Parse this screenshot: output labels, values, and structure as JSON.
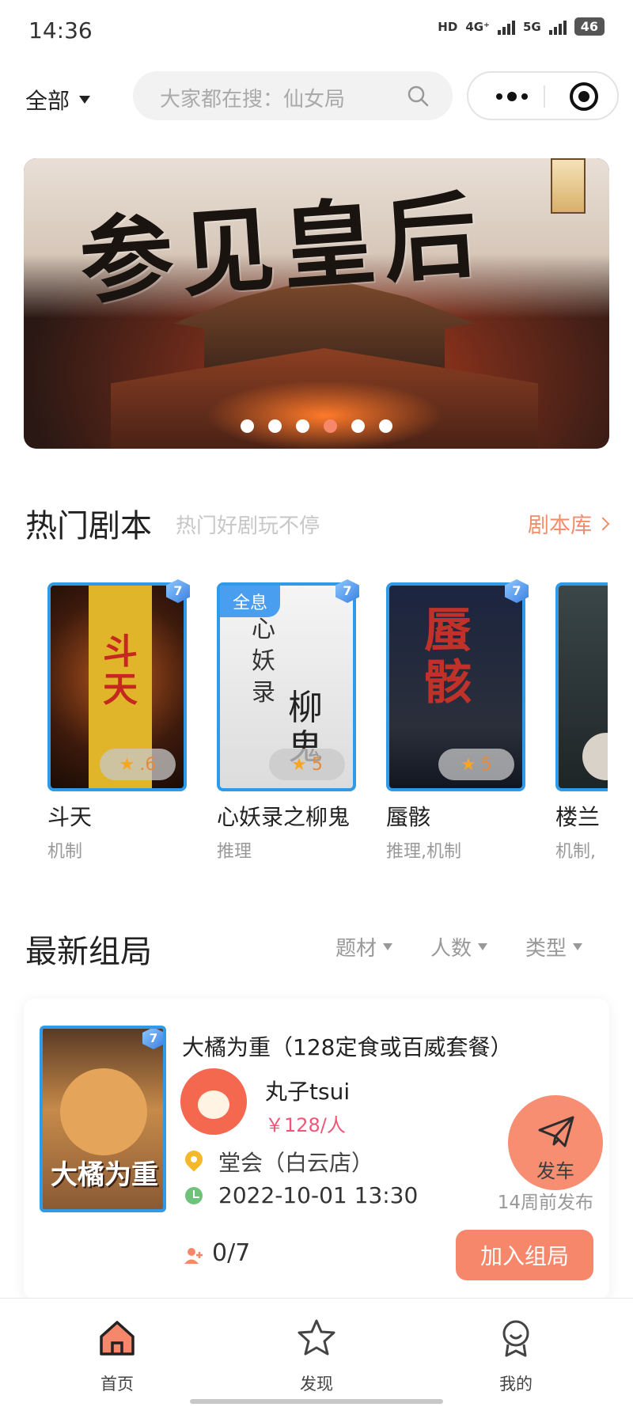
{
  "status_bar": {
    "time": "14:36",
    "network_1": "4G⁺",
    "network_2": "5G",
    "hd": "HD",
    "battery": "46"
  },
  "top": {
    "region": "全部",
    "search_placeholder": "大家都在搜：仙女局"
  },
  "banner": {
    "title": "参见皇后",
    "slide_count": 6,
    "active_index": 3
  },
  "hot": {
    "title": "热门剧本",
    "subtitle": "热门好剧玩不停",
    "more_label": "剧本库",
    "scripts": [
      {
        "name": "斗天",
        "genre": "机制",
        "rating": ".6",
        "cover_text": "斗天",
        "tag": ""
      },
      {
        "name": "心妖录之柳鬼",
        "genre": "推理",
        "rating": "5",
        "cover_text": "心妖录",
        "tag": "全息"
      },
      {
        "name": "蜃骸",
        "genre": "推理,机制",
        "rating": "5",
        "cover_text": "蜃骸",
        "tag": ""
      },
      {
        "name": "楼兰",
        "genre": "机制,",
        "rating": "",
        "cover_text": "",
        "tag": ""
      }
    ]
  },
  "latest": {
    "title": "最新组局",
    "filters": [
      "题材",
      "人数",
      "类型"
    ],
    "group": {
      "title": "大橘为重（128定食或百威套餐）",
      "cover_text": "大橘为重",
      "host": "丸子tsui",
      "price": "￥128/人",
      "location": "堂会（白云店）",
      "time": "2022-10-01 13:30",
      "posted": "14周前发布",
      "people": "0/7",
      "join_label": "加入组局"
    }
  },
  "fab": {
    "label": "发车"
  },
  "tabs": [
    {
      "label": "首页",
      "active": true
    },
    {
      "label": "发现",
      "active": false
    },
    {
      "label": "我的",
      "active": false
    }
  ],
  "colors": {
    "accent": "#f7876a",
    "price": "#f0567a",
    "border_blue": "#2f9be8"
  }
}
